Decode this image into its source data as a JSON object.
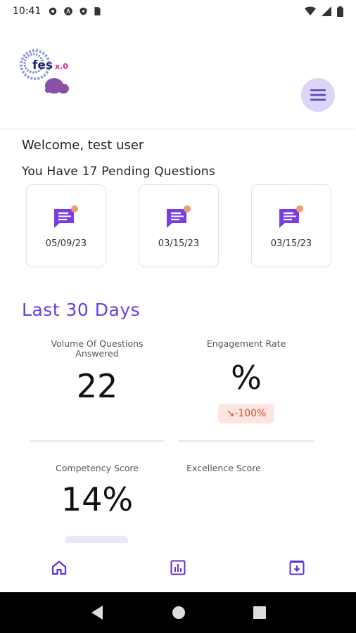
{
  "status_bar": {
    "time": "10:41",
    "left_icons": [
      "settings-icon",
      "app-a-icon",
      "shield-icon",
      "sim-icon"
    ],
    "right_icons": [
      "wifi-icon",
      "signal-icon",
      "battery-icon"
    ]
  },
  "header": {
    "logo_text": "fes",
    "logo_suffix": "x.0",
    "menu_icon": "hamburger-icon",
    "menu_bg": "#ddd5f7",
    "accent": "#6a3fe0"
  },
  "welcome_text": "Welcome, test user",
  "pending_text": "You Have 17 Pending Questions",
  "question_cards": [
    {
      "date": "05/09/23",
      "icon": "chat-notification-icon"
    },
    {
      "date": "03/15/23",
      "icon": "chat-notification-icon"
    },
    {
      "date": "03/15/23",
      "icon": "chat-notification-icon"
    }
  ],
  "stats": {
    "title": "Last 30 Days",
    "volume_label_1": "Volume Of Questions",
    "volume_label_2": "Answered",
    "volume_value": "22",
    "engagement_label": "Engagement Rate",
    "engagement_value": "%",
    "engagement_change": "↘-100%",
    "competency_label": "Competency Score",
    "competency_value": "14%",
    "excellence_label": "Excellence Score"
  },
  "bottom_nav": [
    "home-icon",
    "chart-icon",
    "archive-icon"
  ],
  "system_nav": [
    "back-icon",
    "home-circle-icon",
    "recents-icon"
  ]
}
